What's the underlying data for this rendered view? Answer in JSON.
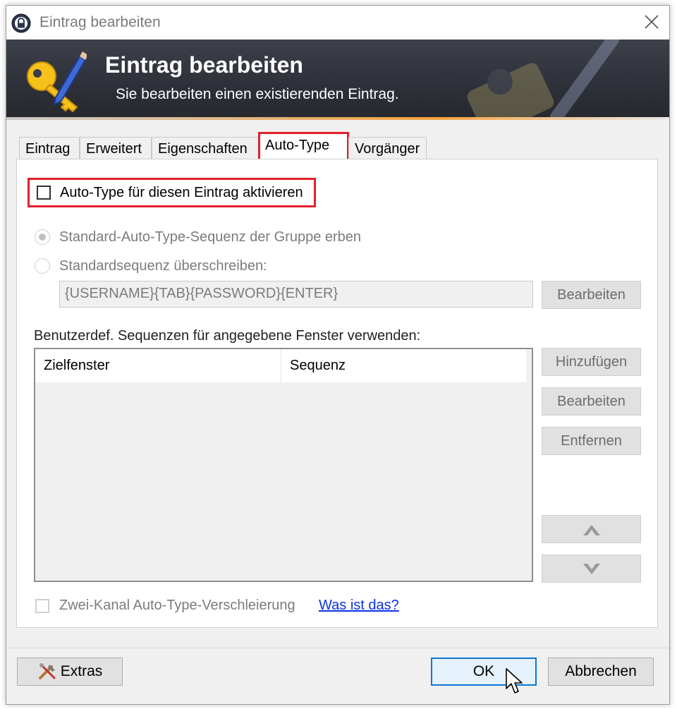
{
  "window": {
    "title": "Eintrag bearbeiten"
  },
  "banner": {
    "title": "Eintrag bearbeiten",
    "subtitle": "Sie bearbeiten einen existierenden Eintrag."
  },
  "tabs": [
    {
      "label": "Eintrag",
      "active": false
    },
    {
      "label": "Erweitert",
      "active": false
    },
    {
      "label": "Eigenschaften",
      "active": false
    },
    {
      "label": "Auto-Type",
      "active": true
    },
    {
      "label": "Vorgänger",
      "active": false
    }
  ],
  "autotype": {
    "enable_label": "Auto-Type für diesen Eintrag aktivieren",
    "enable_checked": false,
    "inherit_label": "Standard-Auto-Type-Sequenz der Gruppe erben",
    "override_label": "Standardsequenz überschreiben:",
    "sequence_value": "{USERNAME}{TAB}{PASSWORD}{ENTER}",
    "edit_default_label": "Bearbeiten",
    "custom_label": "Benutzerdef. Sequenzen für angegebene Fenster verwenden:",
    "columns": [
      "Zielfenster",
      "Sequenz"
    ],
    "rows": [],
    "add_label": "Hinzufügen",
    "edit_label": "Bearbeiten",
    "remove_label": "Entfernen",
    "obfuscation_label": "Zwei-Kanal Auto-Type-Verschleierung",
    "help_link": "Was ist das?"
  },
  "footer": {
    "extras_label": "Extras",
    "ok_label": "OK",
    "cancel_label": "Abbrechen"
  },
  "colors": {
    "highlight": "#e3202a",
    "link": "#0b30e6",
    "default_button_border": "#0a78d7"
  }
}
